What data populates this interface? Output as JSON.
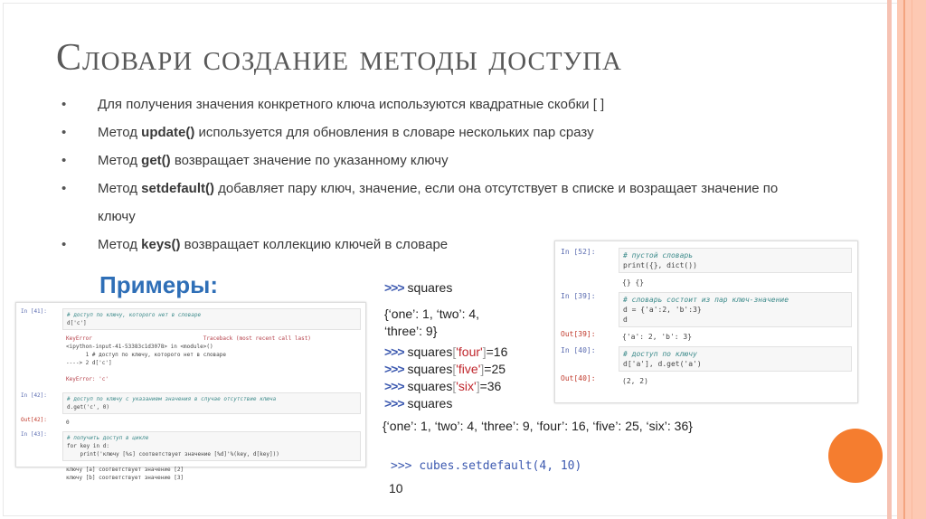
{
  "title": "Словари создание методы доступа",
  "bullets": [
    {
      "pre": "Для получения значения конкретного ключа используются квадратные скобки [ ]",
      "bold": "",
      "post": ""
    },
    {
      "pre": "Метод ",
      "bold": "update()",
      "post": " используется для обновления в словаре нескольких пар сразу"
    },
    {
      "pre": "Метод ",
      "bold": "get()",
      "post": " возвращает значение по указанному ключу"
    },
    {
      "pre": "Метод ",
      "bold": "setdefault()",
      "post": " добавляет пару ключ, значение, если она отсутствует в списке и возращает значение по ключу"
    },
    {
      "pre": "Метод ",
      "bold": "keys()",
      "post": " возвращает коллекцию ключей в словаре"
    }
  ],
  "examples_heading": "Примеры:",
  "left_code": {
    "in41": "In [41]:",
    "in41_comment": "# доступ по ключу, которого нет в словаре",
    "in41_code": "d['c']",
    "err1": "KeyError                                  Traceback (most recent call last)",
    "err2": "<ipython-input-41-53383c1d3078> in <module>()",
    "err3": "      1 # доступ по ключу, которого нет в словаре",
    "err4": "----> 2 d['c']",
    "err5": "KeyError: 'c'",
    "in42": "In [42]:",
    "in42_comment": "# доступ по ключу с указанием значения в случае отсутствие ключа",
    "in42_code": "d.get('c', 0)",
    "out42": "Out[42]:",
    "out42_val": "0",
    "in43": "In [43]:",
    "in43_comment": "# получить доступ в цикле",
    "in43_code": "for key in d:\n    print('ключу [%s] соответствует значение [%d]'%(key, d[key]))",
    "out43": "ключу [a] соответствует значение [2]\nключу [b] соответствует значение [3]"
  },
  "right_code": {
    "in52": "In [52]:",
    "in52_comment": "# пустой словарь",
    "in52_code": "print({}, dict())",
    "out52_val": "{} {}",
    "in39": "In [39]:",
    "in39_comment": "# словарь состоит из пар ключ-значение",
    "in39_code": "d = {'a':2, 'b':3}\nd",
    "out39": "Out[39]:",
    "out39_val": "{'a': 2, 'b': 3}",
    "in40": "In [40]:",
    "in40_comment": "# доступ по ключу",
    "in40_code": "d['a'], d.get('a')",
    "out40": "Out[40]:",
    "out40_val": "(2, 2)"
  },
  "middle": {
    "prompt": ">>>",
    "l1": "squares",
    "l2": "{‘one’: 1, ‘two’: 4,",
    "l3": "‘three’: 9}",
    "l4_a": "squares",
    "l4_k": "'four'",
    "l4_b": "=16",
    "l5_a": "squares",
    "l5_k": "'five'",
    "l5_b": "=25",
    "l6_a": "squares",
    "l6_k": "'six'",
    "l6_b": "=36",
    "l7": "squares",
    "result": "{‘one’: 1, ‘two’: 4, ‘three’: 9, ‘four’: 16, ‘five’: 25, ‘six’: 36}",
    "setdefault_code": "cubes.setdefault(4, 10)",
    "setdefault_result": "10"
  },
  "colors": {
    "accent": "#f57d2f",
    "heading": "#2f6fb7"
  }
}
